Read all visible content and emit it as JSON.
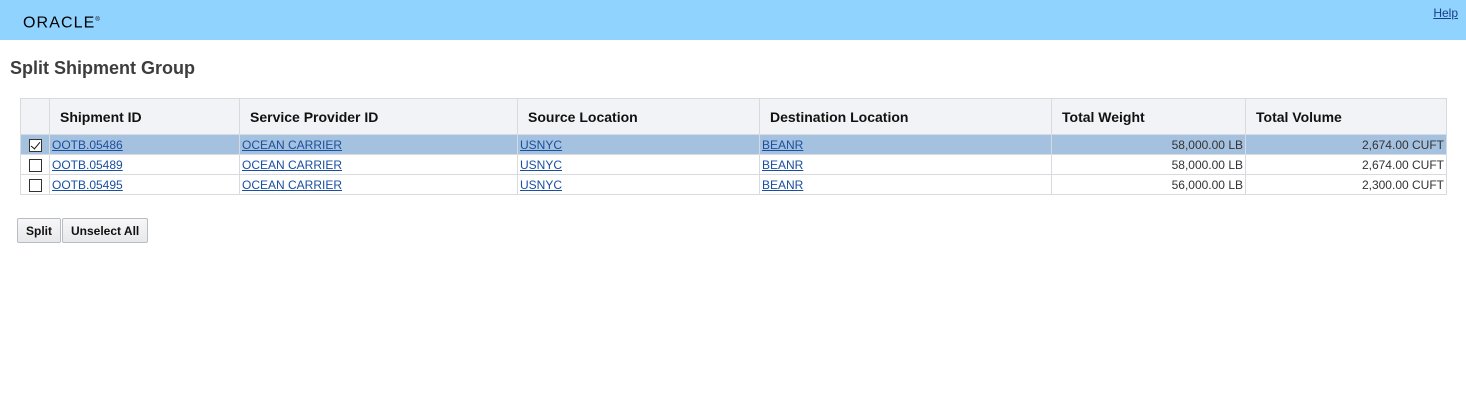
{
  "header": {
    "logo_text": "ORACLE",
    "logo_mark": "®",
    "help_label": "Help"
  },
  "page": {
    "title": "Split Shipment Group"
  },
  "table": {
    "columns": [
      "",
      "Shipment ID",
      "Service Provider ID",
      "Source Location",
      "Destination Location",
      "Total Weight",
      "Total Volume"
    ],
    "rows": [
      {
        "checked": true,
        "shipment_id": "OOTB.05486",
        "service_provider": "OCEAN CARRIER",
        "source": "USNYC",
        "destination": "BEANR",
        "weight": "58,000.00 LB",
        "volume": "2,674.00 CUFT"
      },
      {
        "checked": false,
        "shipment_id": "OOTB.05489",
        "service_provider": "OCEAN CARRIER",
        "source": "USNYC",
        "destination": "BEANR",
        "weight": "58,000.00 LB",
        "volume": "2,674.00 CUFT"
      },
      {
        "checked": false,
        "shipment_id": "OOTB.05495",
        "service_provider": "OCEAN CARRIER",
        "source": "USNYC",
        "destination": "BEANR",
        "weight": "56,000.00 LB",
        "volume": "2,300.00 CUFT"
      }
    ]
  },
  "actions": {
    "split_label": "Split",
    "unselect_all_label": "Unselect All"
  },
  "colors": {
    "header_bg": "#8fd3fe",
    "selected_row_bg": "#a4c2e0",
    "link": "#1a4fa0"
  }
}
